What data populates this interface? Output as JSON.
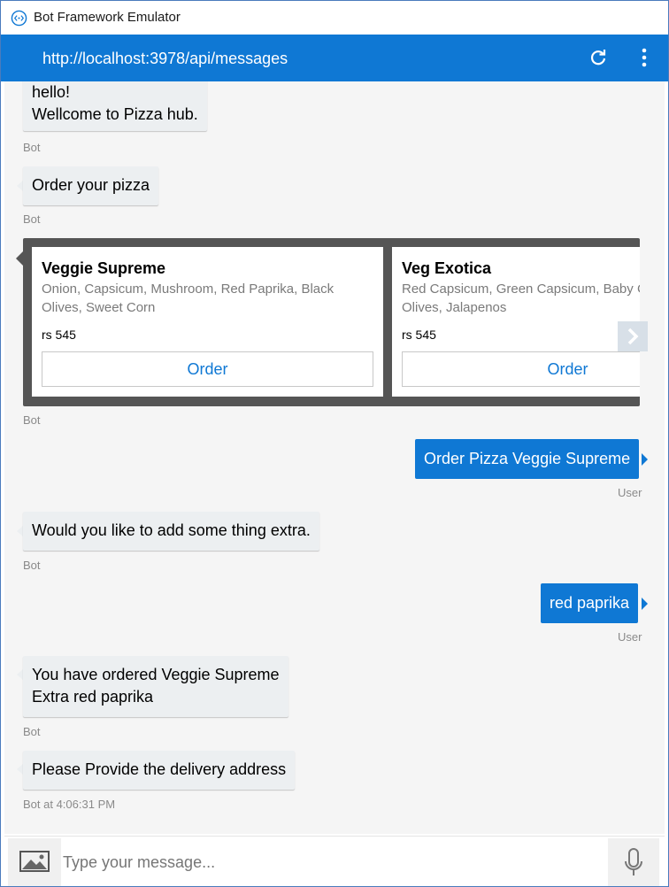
{
  "window": {
    "title": "Bot Framework Emulator"
  },
  "header": {
    "url": "http://localhost:3978/api/messages"
  },
  "messages": [
    {
      "from": "bot",
      "lines": [
        "hello!",
        "Wellcome to Pizza hub."
      ],
      "meta": "Bot"
    },
    {
      "from": "bot",
      "lines": [
        "Order your pizza"
      ],
      "meta": "Bot"
    },
    {
      "from": "bot",
      "type": "carousel",
      "meta": "Bot"
    },
    {
      "from": "user",
      "lines": [
        "Order Pizza Veggie Supreme"
      ],
      "meta": "User"
    },
    {
      "from": "bot",
      "lines": [
        "Would you like to add some thing extra."
      ],
      "meta": "Bot"
    },
    {
      "from": "user",
      "lines": [
        "red paprika"
      ],
      "meta": "User"
    },
    {
      "from": "bot",
      "lines": [
        "You have ordered Veggie Supreme",
        "Extra red paprika"
      ],
      "meta": "Bot"
    },
    {
      "from": "bot",
      "lines": [
        "Please Provide the delivery address"
      ],
      "meta": "Bot at 4:06:31 PM"
    }
  ],
  "carousel": {
    "cards": [
      {
        "title": "Veggie Supreme",
        "subtitle": "Onion, Capsicum, Mushroom, Red Paprika, Black Olives, Sweet Corn",
        "price": "rs 545",
        "button": "Order"
      },
      {
        "title": "Veg Exotica",
        "subtitle": "Red Capsicum, Green Capsicum, Baby Corn, Black Olives, Jalapenos",
        "price": "rs 545",
        "button": "Order"
      }
    ]
  },
  "input": {
    "placeholder": "Type your message..."
  },
  "icons": {
    "app": "bot-emulator-icon",
    "refresh": "refresh-icon",
    "menu": "vertical-ellipsis-icon",
    "next": "chevron-right-icon",
    "upload": "image-icon",
    "mic": "microphone-icon"
  },
  "colors": {
    "accent": "#0f78d4",
    "bot_bubble": "#eceff1",
    "carousel_bg": "#555555"
  }
}
